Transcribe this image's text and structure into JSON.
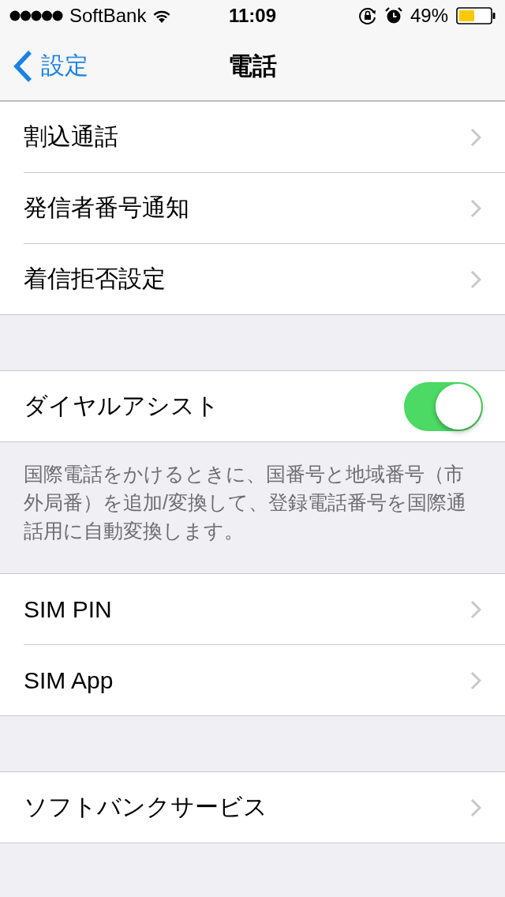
{
  "status_bar": {
    "carrier": "SoftBank",
    "time": "11:09",
    "battery": "49%"
  },
  "nav_bar": {
    "back": "設定",
    "title": "電話"
  },
  "sections": [
    {
      "rows": [
        {
          "kind": "link",
          "label": "割込通話"
        },
        {
          "kind": "link",
          "label": "発信者番号通知"
        },
        {
          "kind": "link",
          "label": "着信拒否設定"
        }
      ]
    },
    {
      "rows": [
        {
          "kind": "toggle",
          "label": "ダイヤルアシスト",
          "on": true
        }
      ],
      "footer": "国際電話をかけるときに、国番号と地域番号（市外局番）を追加/変換して、登録電話番号を国際通話用に自動変換します。"
    },
    {
      "rows": [
        {
          "kind": "link",
          "label": "SIM PIN"
        },
        {
          "kind": "link",
          "label": "SIM App"
        }
      ]
    },
    {
      "rows": [
        {
          "kind": "link",
          "label": "ソフトバンクサービス"
        }
      ]
    }
  ]
}
